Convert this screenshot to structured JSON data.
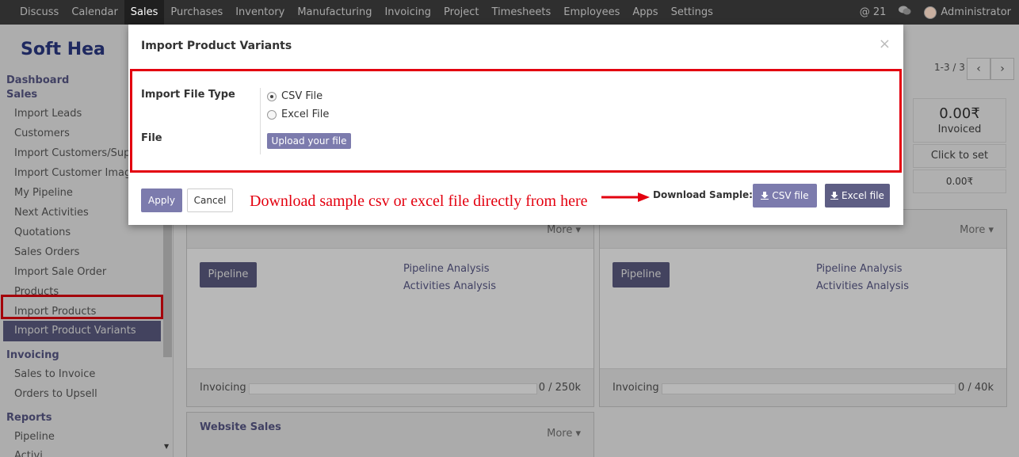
{
  "navbar": {
    "menu": [
      "Discuss",
      "Calendar",
      "Sales",
      "Purchases",
      "Inventory",
      "Manufacturing",
      "Invoicing",
      "Project",
      "Timesheets",
      "Employees",
      "Apps",
      "Settings"
    ],
    "active": "Sales",
    "notifications": "21",
    "user": "Administrator",
    "icons": [
      "at-icon",
      "chat-icon"
    ]
  },
  "brand": {
    "logo": "Soft Hea"
  },
  "sidebar": {
    "dashboard": "Dashboard",
    "sales_heading": "Sales",
    "sales_items": [
      "Import Leads",
      "Customers",
      "Import Customers/Suppl...",
      "Import Customer Image",
      "My Pipeline",
      "Next Activities",
      "Quotations",
      "Sales Orders",
      "Import Sale Order",
      "Products",
      "Import Products",
      "Import Product Variants"
    ],
    "invoicing_heading": "Invoicing",
    "invoicing_items": [
      "Sales to Invoice",
      "Orders to Upsell"
    ],
    "reports_heading": "Reports",
    "reports_items": [
      "Pipeline",
      "Activi..."
    ]
  },
  "pager": {
    "text": "1-3 / 3",
    "prev": "‹",
    "next": "›"
  },
  "kpi": {
    "amount": "0.00₹",
    "amount_label": "Invoiced",
    "click": "Click to set",
    "target": "0.00₹"
  },
  "cards": [
    {
      "title": "",
      "more": "More ▾",
      "pipeline": "Pipeline",
      "links": [
        "Pipeline Analysis",
        "Activities Analysis"
      ],
      "invoicing_label": "Invoicing",
      "invoicing_value": "0 / 250k"
    },
    {
      "title": "",
      "more": "More ▾",
      "pipeline": "Pipeline",
      "links": [
        "Pipeline Analysis",
        "Activities Analysis"
      ],
      "invoicing_label": "Invoicing",
      "invoicing_value": "0 / 40k"
    },
    {
      "title": "Website Sales",
      "more": "More ▾"
    }
  ],
  "modal": {
    "title": "Import Product Variants",
    "close": "×",
    "file_type_label": "Import File Type",
    "options": [
      "CSV File",
      "Excel File"
    ],
    "selected": "CSV File",
    "file_label": "File",
    "upload": "Upload your file",
    "apply": "Apply",
    "cancel": "Cancel",
    "annotation": "Download sample csv or excel file directly from here",
    "download_label": "Download Sample:",
    "csv_button": "CSV file",
    "excel_button": "Excel file",
    "colors": {
      "annotation": "#e3000f",
      "primary": "#7c7bad",
      "excel": "#5e5e84"
    }
  }
}
